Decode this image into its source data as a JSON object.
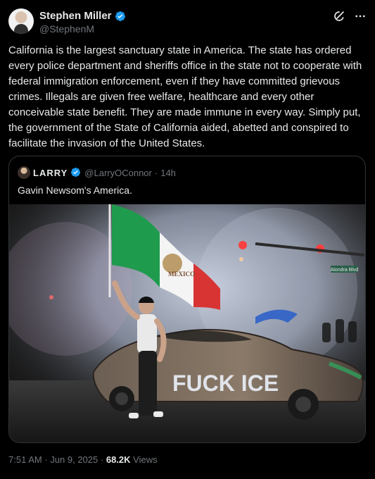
{
  "author": {
    "name": "Stephen Miller",
    "handle": "@StephenM"
  },
  "tweet": {
    "text": "California is the largest sanctuary state in America. The state has ordered every police department and sheriffs office in the state not to cooperate with federal immigration enforcement, even if they have committed grievous crimes. Illegals are given free welfare, healthcare and every other conceivable state benefit. They are made immune in every way. Simply put, the government of the State of California aided, abetted and conspired to facilitate the invasion of the United States."
  },
  "quote": {
    "name": "LARRY",
    "handle": "@LarryOConnor",
    "separator": "·",
    "age": "14h",
    "text": "Gavin Newsom's America.",
    "image_text": {
      "flag_text": "MEXICO",
      "graffiti": "FUCK ICE",
      "street_sign": "Alondra Blvd"
    }
  },
  "footer": {
    "time": "7:51 AM",
    "separator": "·",
    "date": "Jun 9, 2025",
    "separator2": "·",
    "views_count": "68.2K",
    "views_label": "Views"
  },
  "colors": {
    "background": "#000000",
    "text": "#e7e9ea",
    "muted": "#71767b",
    "border": "#2f3336",
    "verified": "#1d9bf0"
  },
  "icons": [
    "verified-badge-icon",
    "grok-icon",
    "more-icon"
  ]
}
